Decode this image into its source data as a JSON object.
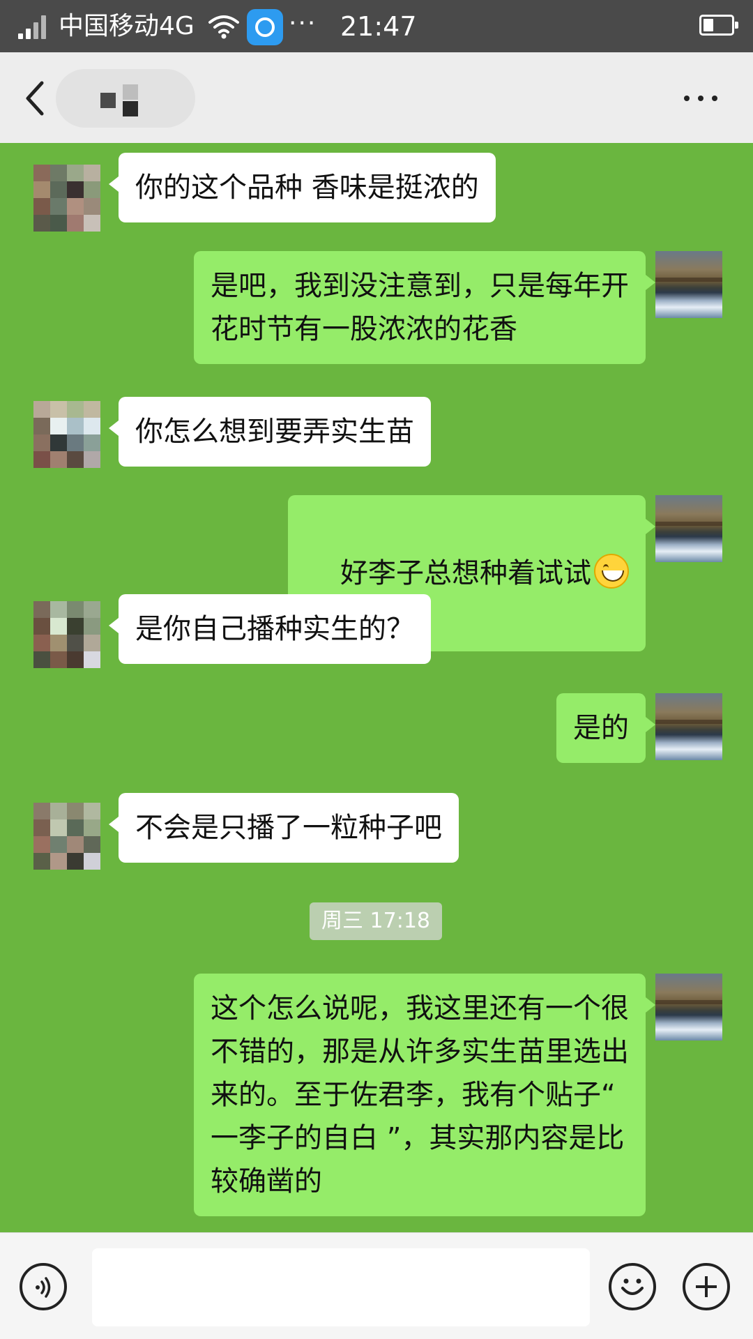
{
  "status_bar": {
    "carrier": "中国移动4G",
    "more": "···",
    "time": "21:47"
  },
  "header": {
    "back_icon": "chevron-left-icon",
    "menu_icon": "more-horizontal-icon"
  },
  "messages": [
    {
      "side": "them",
      "text": "你的这个品种 香味是挺浓的"
    },
    {
      "side": "me",
      "text": "是吧，我到没注意到，只是每年开\n花时节有一股浓浓的花香"
    },
    {
      "side": "them",
      "text": "你怎么想到要弄实生苗"
    },
    {
      "side": "me",
      "text": "好李子总想种着试试",
      "emoji": "grinning-face-emoji"
    },
    {
      "side": "them",
      "text": "是你自己播种实生的？"
    },
    {
      "side": "me",
      "text": "是的"
    },
    {
      "side": "them",
      "text": "不会是只播了一粒种子吧"
    },
    {
      "side": "me",
      "text": "这个怎么说呢，我这里还有一个很\n不错的，那是从许多实生苗里选出\n来的。至于佐君李，我有个贴子“\n一李子的自白 ”，其实那内容是比\n较确凿的"
    }
  ],
  "timestamp": "周三 17:18",
  "input_bar": {
    "voice_icon": "voice-icon",
    "emoji_icon": "emoji-icon",
    "plus_icon": "plus-icon",
    "text_value": ""
  },
  "colors": {
    "chat_background": "#6ab63f",
    "my_bubble": "#95ec69",
    "their_bubble": "#ffffff",
    "status_bar": "#4a4a4a",
    "header": "#ededed"
  }
}
